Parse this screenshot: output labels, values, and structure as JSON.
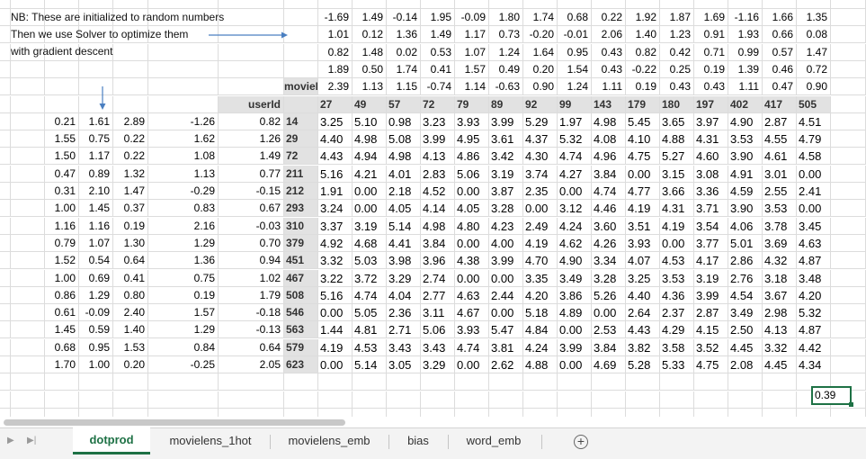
{
  "notes": [
    "NB: These are initialized to random numbers",
    "Then we use Solver to optimize them",
    "with gradient descent"
  ],
  "labels": {
    "movieId": "movieId",
    "userId": "userId"
  },
  "movie_latents": [
    [
      "-1.69",
      "1.49",
      "-0.14",
      "1.95",
      "-0.09",
      "1.80",
      "1.74",
      "0.68",
      "0.22",
      "1.92",
      "1.87",
      "1.69",
      "-1.16",
      "1.66",
      "1.35"
    ],
    [
      "1.01",
      "0.12",
      "1.36",
      "1.49",
      "1.17",
      "0.73",
      "-0.20",
      "-0.01",
      "2.06",
      "1.40",
      "1.23",
      "0.91",
      "1.93",
      "0.66",
      "0.08"
    ],
    [
      "0.82",
      "1.48",
      "0.02",
      "0.53",
      "1.07",
      "1.24",
      "1.64",
      "0.95",
      "0.43",
      "0.82",
      "0.42",
      "0.71",
      "0.99",
      "0.57",
      "1.47"
    ],
    [
      "1.89",
      "0.50",
      "1.74",
      "0.41",
      "1.57",
      "0.49",
      "0.20",
      "1.54",
      "0.43",
      "-0.22",
      "0.25",
      "0.19",
      "1.39",
      "0.46",
      "0.72"
    ],
    [
      "2.39",
      "1.13",
      "1.15",
      "-0.74",
      "1.14",
      "-0.63",
      "0.90",
      "1.24",
      "1.11",
      "0.19",
      "0.43",
      "0.43",
      "1.11",
      "0.47",
      "0.90"
    ]
  ],
  "movie_ids": [
    "27",
    "49",
    "57",
    "72",
    "79",
    "89",
    "92",
    "99",
    "143",
    "179",
    "180",
    "197",
    "402",
    "417",
    "505"
  ],
  "user_ids": [
    "14",
    "29",
    "72",
    "211",
    "212",
    "293",
    "310",
    "379",
    "451",
    "467",
    "508",
    "546",
    "563",
    "579",
    "623"
  ],
  "user_latents": [
    [
      "0.21",
      "1.61",
      "2.89",
      "-1.26",
      "0.82"
    ],
    [
      "1.55",
      "0.75",
      "0.22",
      "1.62",
      "1.26"
    ],
    [
      "1.50",
      "1.17",
      "0.22",
      "1.08",
      "1.49"
    ],
    [
      "0.47",
      "0.89",
      "1.32",
      "1.13",
      "0.77"
    ],
    [
      "0.31",
      "2.10",
      "1.47",
      "-0.29",
      "-0.15"
    ],
    [
      "1.00",
      "1.45",
      "0.37",
      "0.83",
      "0.67"
    ],
    [
      "1.16",
      "1.16",
      "0.19",
      "2.16",
      "-0.03"
    ],
    [
      "0.79",
      "1.07",
      "1.30",
      "1.29",
      "0.70"
    ],
    [
      "1.52",
      "0.54",
      "0.64",
      "1.36",
      "0.94"
    ],
    [
      "1.00",
      "0.69",
      "0.41",
      "0.75",
      "1.02"
    ],
    [
      "0.86",
      "1.29",
      "0.80",
      "0.19",
      "1.79"
    ],
    [
      "0.61",
      "-0.09",
      "2.40",
      "1.57",
      "-0.18"
    ],
    [
      "1.45",
      "0.59",
      "1.40",
      "1.29",
      "-0.13"
    ],
    [
      "0.68",
      "0.95",
      "1.53",
      "0.84",
      "0.64"
    ],
    [
      "1.70",
      "1.00",
      "0.20",
      "-0.25",
      "2.05"
    ]
  ],
  "ratings": [
    [
      "3.25",
      "5.10",
      "0.98",
      "3.23",
      "3.93",
      "3.99",
      "5.29",
      "1.97",
      "4.98",
      "5.45",
      "3.65",
      "3.97",
      "4.90",
      "2.87",
      "4.51"
    ],
    [
      "4.40",
      "4.98",
      "5.08",
      "3.99",
      "4.95",
      "3.61",
      "4.37",
      "5.32",
      "4.08",
      "4.10",
      "4.88",
      "4.31",
      "3.53",
      "4.55",
      "4.79"
    ],
    [
      "4.43",
      "4.94",
      "4.98",
      "4.13",
      "4.86",
      "3.42",
      "4.30",
      "4.74",
      "4.96",
      "4.75",
      "5.27",
      "4.60",
      "3.90",
      "4.61",
      "4.58"
    ],
    [
      "5.16",
      "4.21",
      "4.01",
      "2.83",
      "5.06",
      "3.19",
      "3.74",
      "4.27",
      "3.84",
      "0.00",
      "3.15",
      "3.08",
      "4.91",
      "3.01",
      "0.00"
    ],
    [
      "1.91",
      "0.00",
      "2.18",
      "4.52",
      "0.00",
      "3.87",
      "2.35",
      "0.00",
      "4.74",
      "4.77",
      "3.66",
      "3.36",
      "4.59",
      "2.55",
      "2.41"
    ],
    [
      "3.24",
      "0.00",
      "4.05",
      "4.14",
      "4.05",
      "3.28",
      "0.00",
      "3.12",
      "4.46",
      "4.19",
      "4.31",
      "3.71",
      "3.90",
      "3.53",
      "0.00"
    ],
    [
      "3.37",
      "3.19",
      "5.14",
      "4.98",
      "4.80",
      "4.23",
      "2.49",
      "4.24",
      "3.60",
      "3.51",
      "4.19",
      "3.54",
      "4.06",
      "3.78",
      "3.45"
    ],
    [
      "4.92",
      "4.68",
      "4.41",
      "3.84",
      "0.00",
      "4.00",
      "4.19",
      "4.62",
      "4.26",
      "3.93",
      "0.00",
      "3.77",
      "5.01",
      "3.69",
      "4.63"
    ],
    [
      "3.32",
      "5.03",
      "3.98",
      "3.96",
      "4.38",
      "3.99",
      "4.70",
      "4.90",
      "3.34",
      "4.07",
      "4.53",
      "4.17",
      "2.86",
      "4.32",
      "4.87"
    ],
    [
      "3.22",
      "3.72",
      "3.29",
      "2.74",
      "0.00",
      "0.00",
      "3.35",
      "3.49",
      "3.28",
      "3.25",
      "3.53",
      "3.19",
      "2.76",
      "3.18",
      "3.48"
    ],
    [
      "5.16",
      "4.74",
      "4.04",
      "2.77",
      "4.63",
      "2.44",
      "4.20",
      "3.86",
      "5.26",
      "4.40",
      "4.36",
      "3.99",
      "4.54",
      "3.67",
      "4.20"
    ],
    [
      "0.00",
      "5.05",
      "2.36",
      "3.11",
      "4.67",
      "0.00",
      "5.18",
      "4.89",
      "0.00",
      "2.64",
      "2.37",
      "2.87",
      "3.49",
      "2.98",
      "5.32"
    ],
    [
      "1.44",
      "4.81",
      "2.71",
      "5.06",
      "3.93",
      "5.47",
      "4.84",
      "0.00",
      "2.53",
      "4.43",
      "4.29",
      "4.15",
      "2.50",
      "4.13",
      "4.87"
    ],
    [
      "4.19",
      "4.53",
      "3.43",
      "3.43",
      "4.74",
      "3.81",
      "4.24",
      "3.99",
      "3.84",
      "3.82",
      "3.58",
      "3.52",
      "4.45",
      "3.32",
      "4.42"
    ],
    [
      "0.00",
      "5.14",
      "3.05",
      "3.29",
      "0.00",
      "2.62",
      "4.88",
      "0.00",
      "4.69",
      "5.28",
      "5.33",
      "4.75",
      "2.08",
      "4.45",
      "4.34"
    ]
  ],
  "selected_cell": "0.39",
  "tabs": [
    "dotprod",
    "movielens_1hot",
    "movielens_emb",
    "bias",
    "word_emb"
  ],
  "active_tab": "dotprod",
  "colors": {
    "accent": "#1e7145",
    "arrow": "#4a7fc1",
    "header_bg": "#e2e2e2",
    "grid": "#dcdcdc"
  }
}
